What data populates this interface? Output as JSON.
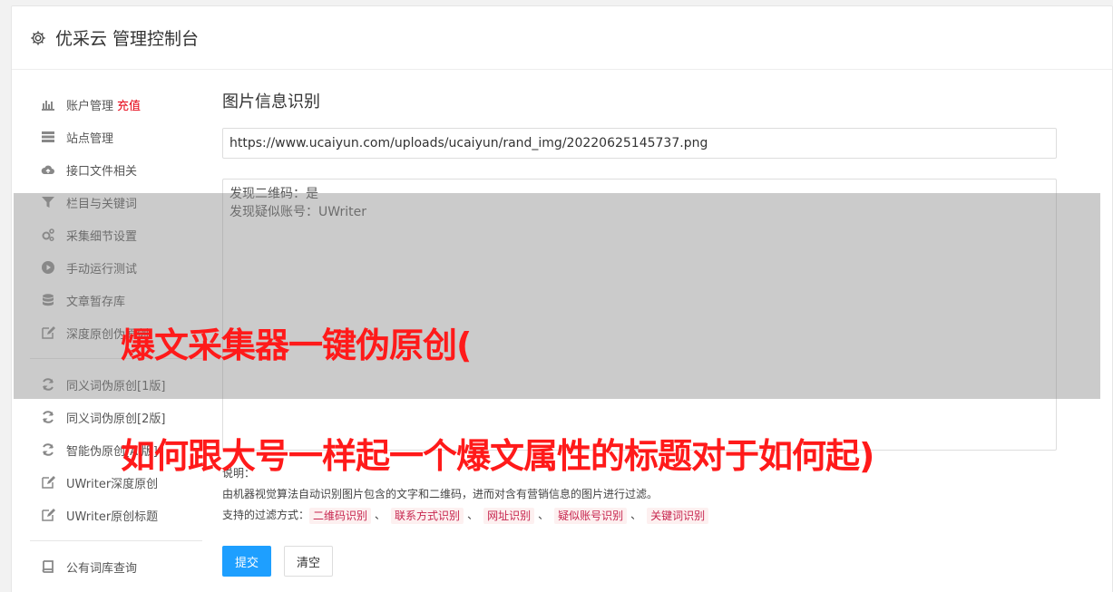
{
  "header": {
    "title": "优采云 管理控制台",
    "icon": "gear-icon"
  },
  "sidebar": {
    "items": [
      {
        "label": "账户管理",
        "badge": "充值",
        "icon": "bar-chart-icon"
      },
      {
        "label": "站点管理",
        "icon": "server-icon"
      },
      {
        "label": "接口文件相关",
        "icon": "cloud-upload-icon"
      },
      {
        "label": "栏目与关键词",
        "icon": "filter-icon"
      },
      {
        "label": "采集细节设置",
        "icon": "gears-icon"
      },
      {
        "label": "手动运行测试",
        "icon": "play-circle-icon"
      },
      {
        "label": "文章暂存库",
        "icon": "database-icon"
      },
      {
        "label": "深度原创伪原创",
        "icon": "edit-icon"
      },
      {
        "label": "同义词伪原创[1版]",
        "icon": "refresh-icon"
      },
      {
        "label": "同义词伪原创[2版]",
        "icon": "refresh-icon"
      },
      {
        "label": "智能伪原创[AI版]",
        "icon": "refresh-icon"
      },
      {
        "label": "UWriter深度原创",
        "icon": "edit-icon"
      },
      {
        "label": "UWriter原创标题",
        "icon": "edit-icon"
      },
      {
        "label": "公有词库查询",
        "icon": "book-icon"
      }
    ]
  },
  "main": {
    "title": "图片信息识别",
    "url_value": "https://www.ucaiyun.com/uploads/ucaiyun/rand_img/20220625145737.png",
    "result_lines": [
      "发现二维码：是",
      "发现疑似账号：UWriter"
    ],
    "desc_label": "说明：",
    "desc_text": "由机器视觉算法自动识别图片包含的文字和二维码，进而对含有营销信息的图片进行过滤。",
    "filter_label": "支持的过滤方式：",
    "filters": [
      "二维码识别",
      "联系方式识别",
      "网址识别",
      "疑似账号识别",
      "关键词识别"
    ],
    "filter_sep": "、",
    "submit_label": "提交",
    "clear_label": "清空"
  },
  "overlay": {
    "line1": "爆文采集器一键伪原创(",
    "line2": "如何跟大号一样起一个爆文属性的标题对于如何起)"
  },
  "colors": {
    "accent": "#1e9fff",
    "badge": "#e60012",
    "overlay_text": "#ff1a1a",
    "tag_text": "#c7254e",
    "tag_bg": "#fdf0f0"
  }
}
